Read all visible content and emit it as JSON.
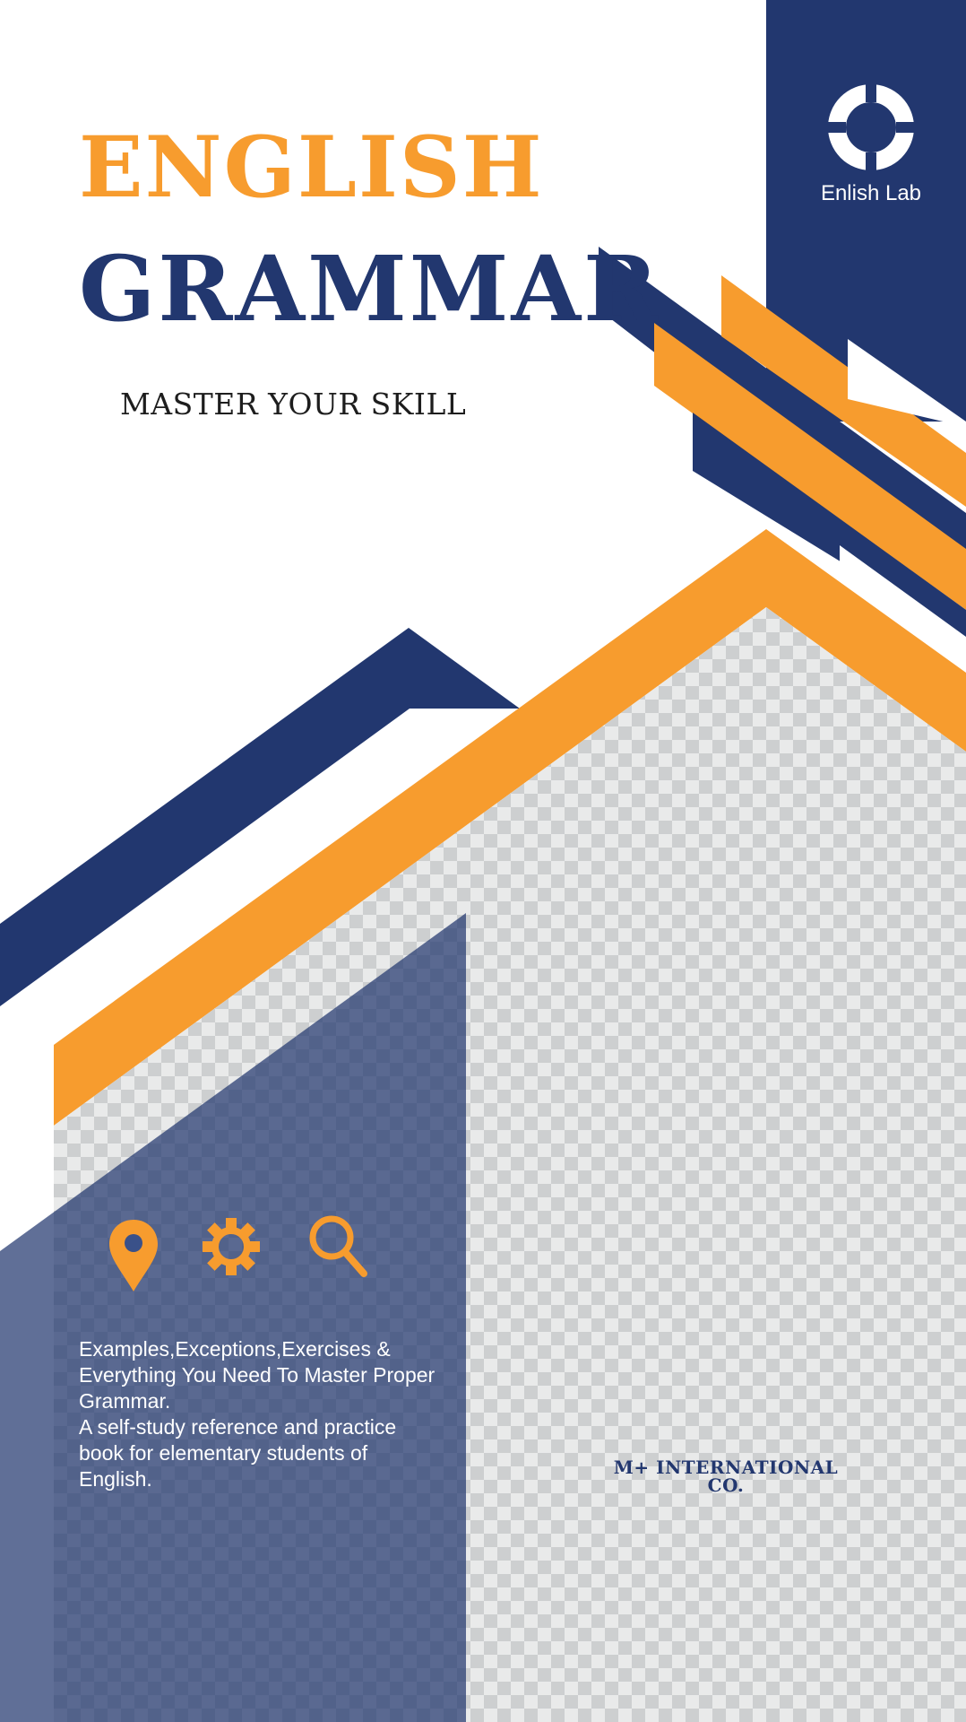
{
  "cover": {
    "title_line1": "ENGLISH",
    "title_line2": "GRAMMAR",
    "tagline": "MASTER YOUR SKILL",
    "brand": "Enlish Lab",
    "description": [
      "Examples,Exceptions,Exercises & Everything You Need To Master Proper Grammar.",
      "A self-study reference and practice book for elementary students of English."
    ],
    "company": "M+ INTERNATIONAL CO."
  },
  "icons": [
    "location-pin-icon",
    "gear-icon",
    "search-icon",
    "ring-logo-icon"
  ],
  "colors": {
    "navy": "#22376f",
    "orange": "#f79c2e",
    "navy_overlay": "#3a5189",
    "checker_light": "#e9eaea",
    "checker_dark": "#cdcfd0",
    "white": "#ffffff"
  }
}
